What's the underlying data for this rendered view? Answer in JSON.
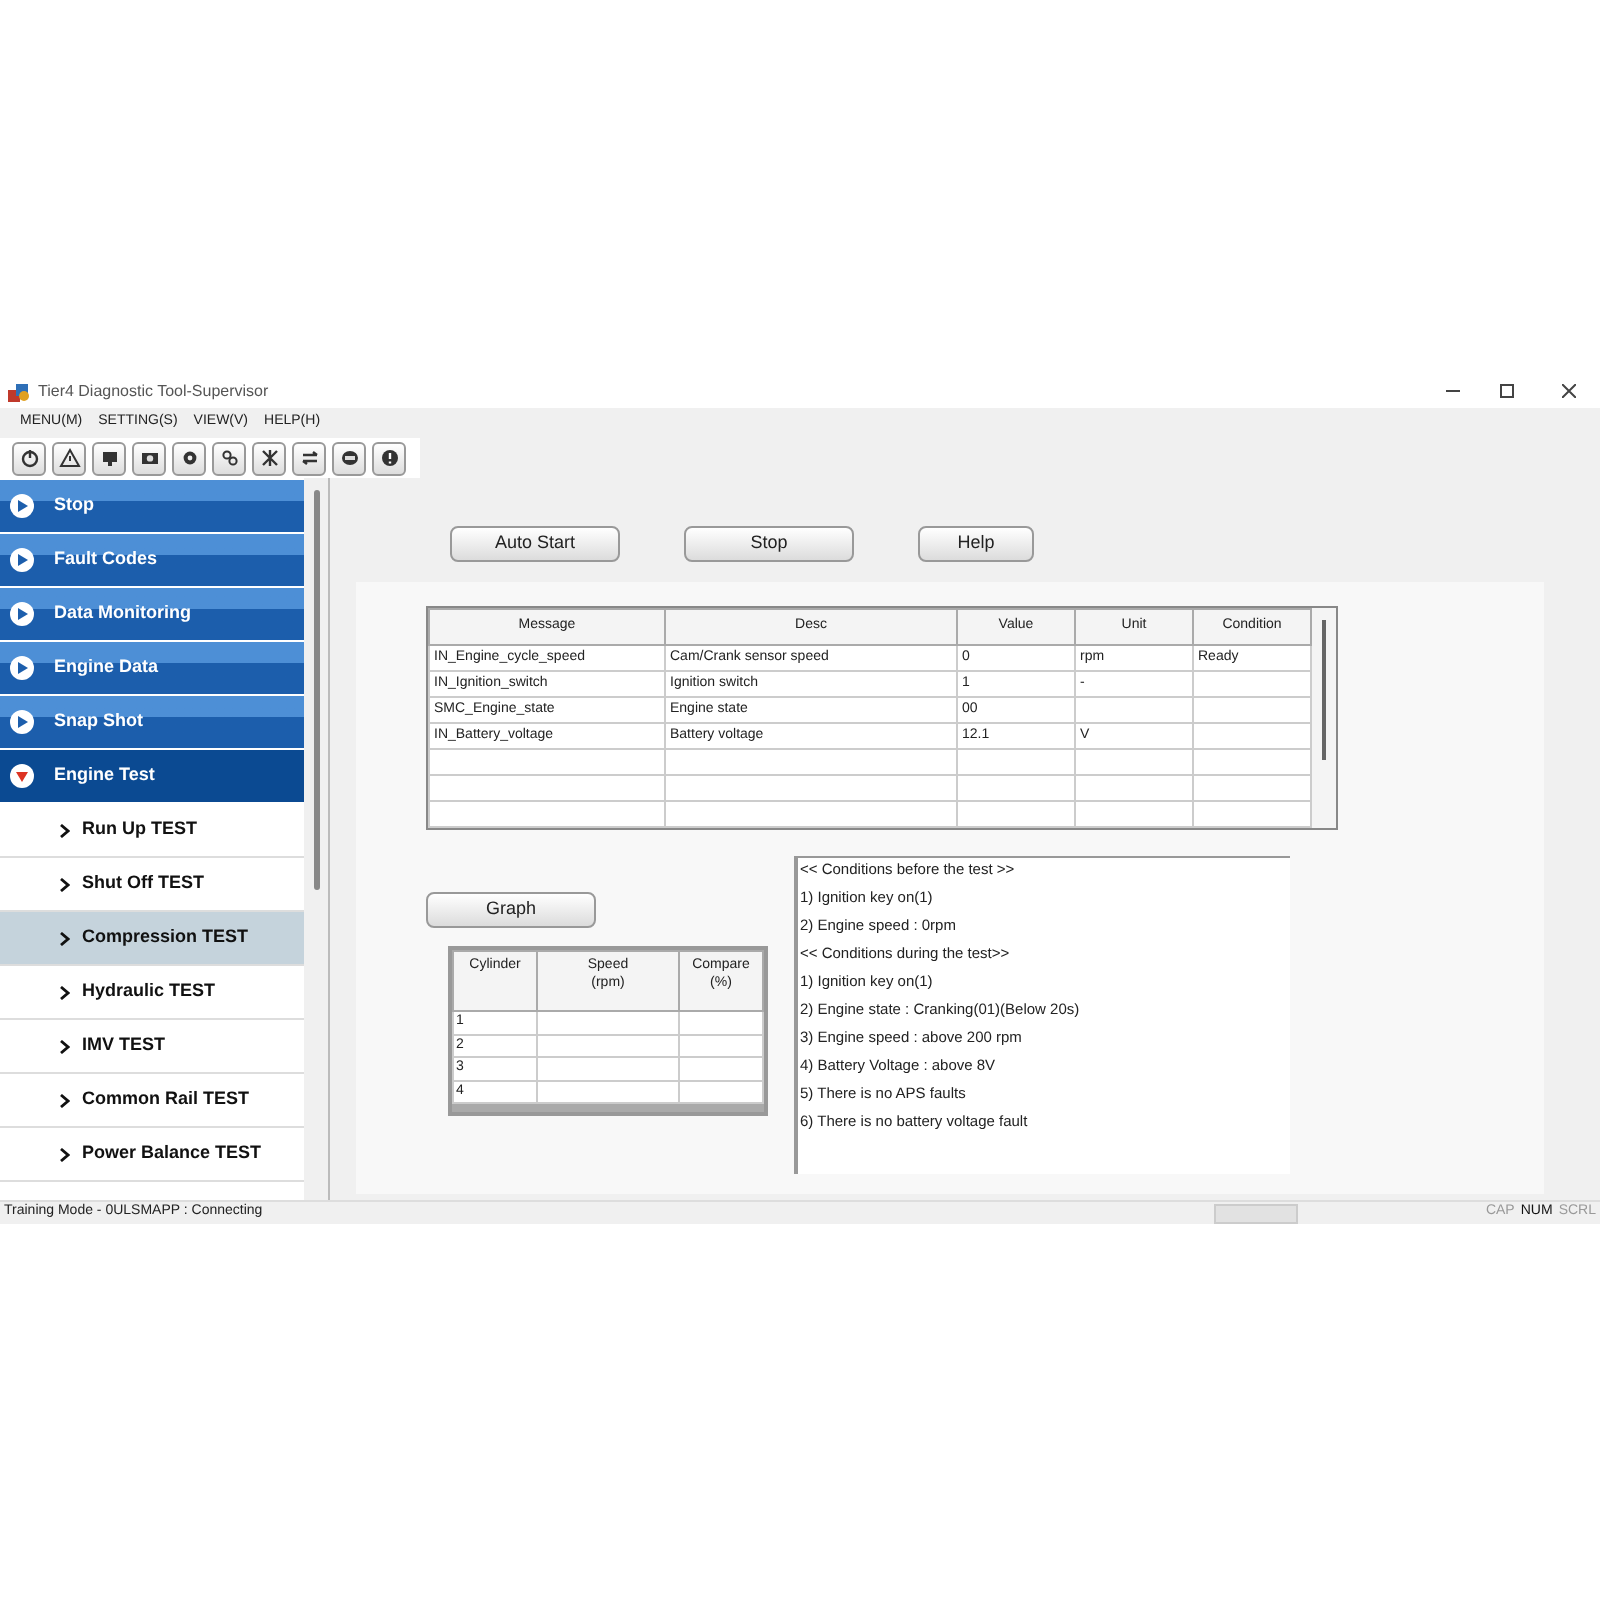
{
  "window": {
    "title": "Tier4 Diagnostic Tool-Supervisor"
  },
  "menu": [
    "MENU(M)",
    "SETTING(S)",
    "VIEW(V)",
    "HELP(H)"
  ],
  "sidebar": {
    "items": [
      {
        "label": "Stop",
        "expanded": false
      },
      {
        "label": "Fault Codes",
        "expanded": false
      },
      {
        "label": "Data Monitoring",
        "expanded": false
      },
      {
        "label": "Engine Data",
        "expanded": false
      },
      {
        "label": "Snap Shot",
        "expanded": false
      },
      {
        "label": "Engine Test",
        "expanded": true,
        "children": [
          {
            "label": "Run Up TEST",
            "selected": false
          },
          {
            "label": "Shut Off TEST",
            "selected": false
          },
          {
            "label": "Compression TEST",
            "selected": true
          },
          {
            "label": "Hydraulic TEST",
            "selected": false
          },
          {
            "label": "IMV TEST",
            "selected": false
          },
          {
            "label": "Common Rail TEST",
            "selected": false
          },
          {
            "label": "Power Balance TEST",
            "selected": false
          }
        ]
      }
    ]
  },
  "buttons": [
    "Auto Start",
    "Stop",
    "Help"
  ],
  "table": {
    "columns": [
      "Message",
      "Desc",
      "Value",
      "Unit",
      "Condition"
    ],
    "rows": [
      [
        "IN_Engine_cycle_speed",
        "Cam/Crank sensor speed",
        "0",
        "rpm",
        "Ready"
      ],
      [
        "IN_Ignition_switch",
        "Ignition switch",
        "1",
        "-",
        null
      ],
      [
        "SMC_Engine_state",
        "Engine state",
        "00",
        null,
        null
      ],
      [
        "IN_Battery_voltage",
        "Battery voltage",
        "12.1",
        "V",
        null
      ]
    ]
  },
  "graph_button": "Graph",
  "cylinder_table": {
    "columns": [
      [
        "Cylinder"
      ],
      [
        "Speed",
        "(rpm)"
      ],
      [
        "Compare",
        "(%)"
      ]
    ],
    "rows": [
      "1",
      "2",
      "3",
      "4"
    ]
  },
  "conditions": [
    "<< Conditions before the test >>",
    "1) Ignition key on(1)",
    "2) Engine speed : 0rpm",
    "<< Conditions during the test>>",
    "1) Ignition key on(1)",
    "2) Engine state : Cranking(01)(Below 20s)",
    "3) Engine speed : above 200 rpm",
    "4) Battery Voltage : above 8V",
    "5) There is no APS faults",
    "6) There is no battery voltage fault"
  ],
  "status_bar": {
    "text": "Training Mode - 0ULSMAPP : Connecting",
    "indicators": [
      {
        "label": "CAP",
        "on": false
      },
      {
        "label": "NUM",
        "on": true
      },
      {
        "label": "SCRL",
        "on": false
      }
    ]
  }
}
